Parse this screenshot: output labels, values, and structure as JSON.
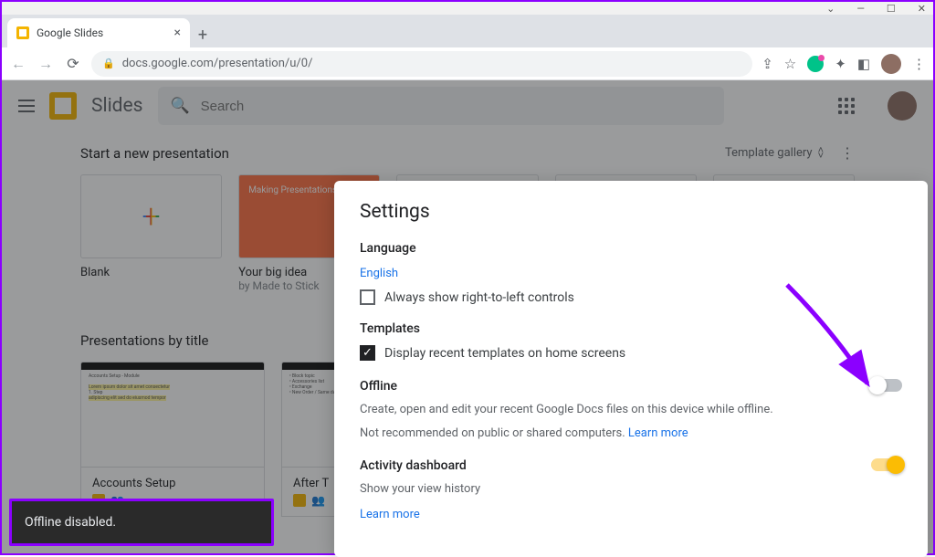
{
  "browser": {
    "tab_title": "Google Slides",
    "url": "docs.google.com/presentation/u/0/"
  },
  "app": {
    "name": "Slides",
    "search_placeholder": "Search"
  },
  "templates_section": {
    "heading": "Start a new presentation",
    "gallery_label": "Template gallery",
    "cards": [
      {
        "title": "Blank",
        "subtitle": ""
      },
      {
        "title": "Your big idea",
        "subtitle": "by Made to Stick",
        "thumb_text": "Making Presentations Stick"
      }
    ]
  },
  "docs_section": {
    "heading": "Presentations by title",
    "cards": [
      {
        "title": "Accounts Setup"
      },
      {
        "title": "After T"
      }
    ]
  },
  "settings": {
    "title": "Settings",
    "language_heading": "Language",
    "language_value": "English",
    "rtl_label": "Always show right-to-left controls",
    "rtl_checked": false,
    "templates_heading": "Templates",
    "templates_label": "Display recent templates on home screens",
    "templates_checked": true,
    "offline_heading": "Offline",
    "offline_desc": "Create, open and edit your recent Google Docs files on this device while offline.",
    "offline_warning": "Not recommended on public or shared computers. ",
    "learn_more": "Learn more",
    "offline_enabled": false,
    "activity_heading": "Activity dashboard",
    "activity_desc": "Show your view history",
    "activity_enabled": true
  },
  "toast": {
    "message": "Offline disabled."
  }
}
